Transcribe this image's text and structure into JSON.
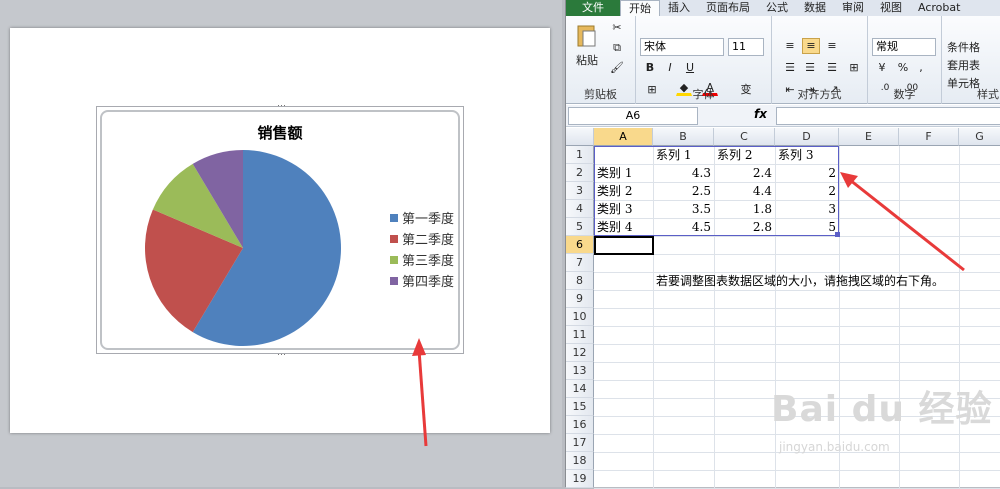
{
  "chart": {
    "title": "销售额",
    "legend": [
      "第一季度",
      "第二季度",
      "第三季度",
      "第四季度"
    ]
  },
  "chart_data": {
    "type": "pie",
    "title": "销售额",
    "categories": [
      "第一季度",
      "第二季度",
      "第三季度",
      "第四季度"
    ],
    "values": [
      8.2,
      3.2,
      1.4,
      1.2
    ],
    "colors": [
      "#4f81bd",
      "#c0504d",
      "#9bbb59",
      "#8064a2"
    ],
    "legend_position": "right"
  },
  "excel": {
    "tabs": [
      "文件",
      "开始",
      "插入",
      "页面布局",
      "公式",
      "数据",
      "审阅",
      "视图",
      "Acrobat"
    ],
    "active_tab": "开始",
    "clipboard": {
      "paste": "粘贴",
      "label": "剪贴板"
    },
    "font": {
      "name": "宋体",
      "size": "11",
      "label": "字体",
      "bold": "B",
      "italic": "I",
      "underline": "U",
      "color_a": "A",
      "wen": "变"
    },
    "alignment": {
      "label": "对齐方式"
    },
    "number": {
      "format": "常规",
      "label": "数字",
      "percent": "%",
      "comma": ","
    },
    "styles": {
      "cond": "条件格",
      "table": "套用表",
      "cell": "单元格",
      "label": "样式"
    },
    "namebox": "A6",
    "fx": "fx",
    "columns": [
      "A",
      "B",
      "C",
      "D",
      "E",
      "F",
      "G"
    ],
    "rows": [
      "1",
      "2",
      "3",
      "4",
      "5",
      "6",
      "7",
      "8",
      "9",
      "10",
      "11",
      "12",
      "13",
      "14",
      "15",
      "16",
      "17",
      "18",
      "19"
    ],
    "series_headers": [
      "系列 1",
      "系列 2",
      "系列 3"
    ],
    "data_rows": [
      {
        "label": "类别 1",
        "v1": "4.3",
        "v2": "2.4",
        "v3": "2"
      },
      {
        "label": "类别 2",
        "v1": "2.5",
        "v2": "4.4",
        "v3": "2"
      },
      {
        "label": "类别 3",
        "v1": "3.5",
        "v2": "1.8",
        "v3": "3"
      },
      {
        "label": "类别 4",
        "v1": "4.5",
        "v2": "2.8",
        "v3": "5"
      }
    ],
    "note": "若要调整图表数据区域的大小，请拖拽区域的右下角。"
  },
  "watermark": {
    "brand": "Bai du 经验",
    "url": "jingyan.baidu.com"
  },
  "accent": {
    "arrow": "#e83a3a",
    "selection": "#f9d98c",
    "range_border": "#5b5fc7"
  }
}
